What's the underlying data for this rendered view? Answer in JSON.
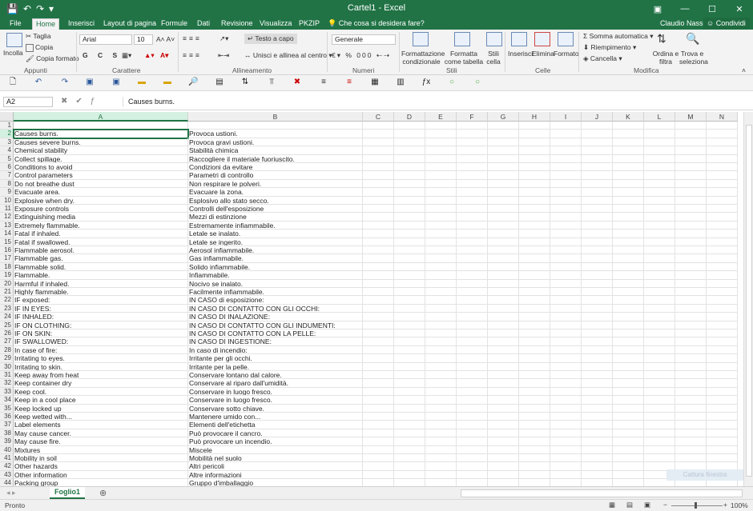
{
  "window": {
    "title": "Cartel1 - Excel",
    "user": "Claudio Nasso",
    "share": "Condividi"
  },
  "tabs": [
    "File",
    "Home",
    "Inserisci",
    "Layout di pagina",
    "Formule",
    "Dati",
    "Revisione",
    "Visualizza",
    "PKZIP"
  ],
  "tell_me": "Che cosa si desidera fare?",
  "ribbon": {
    "clipboard": {
      "paste": "Incolla",
      "cut": "Taglia",
      "copy": "Copia",
      "format_painter": "Copia formato",
      "group": "Appunti"
    },
    "font": {
      "name": "Arial",
      "size": "10",
      "group": "Carattere"
    },
    "alignment": {
      "wrap": "Testo a capo",
      "merge": "Unisci e allinea al centro",
      "group": "Allineamento"
    },
    "number": {
      "format": "Generale",
      "group": "Numeri"
    },
    "styles": {
      "cond": "Formattazione condizionale",
      "table": "Formatta come tabella",
      "cell": "Stili cella",
      "group": "Stili"
    },
    "cells": {
      "insert": "Inserisci",
      "delete": "Elimina",
      "format": "Formato",
      "group": "Celle"
    },
    "editing": {
      "autosum": "Somma automatica",
      "fill": "Riempimento",
      "clear": "Cancella",
      "sort": "Ordina e filtra",
      "find": "Trova e seleziona",
      "group": "Modifica"
    }
  },
  "formula_bar": {
    "name_box": "A2",
    "content": "Causes burns."
  },
  "columns": [
    "A",
    "B",
    "C",
    "D",
    "E",
    "F",
    "G",
    "H",
    "I",
    "J",
    "K",
    "L",
    "M",
    "N"
  ],
  "rows": [
    [
      "1",
      "",
      ""
    ],
    [
      "2",
      "Causes burns.",
      "Provoca ustioni."
    ],
    [
      "3",
      "Causes severe burns.",
      "Provoca gravi ustioni."
    ],
    [
      "4",
      "Chemical stability",
      "Stabilità chimica"
    ],
    [
      "5",
      "Collect spillage.",
      "Raccogliere il materiale fuoriuscito."
    ],
    [
      "6",
      "Conditions to avoid",
      "Condizioni da evitare"
    ],
    [
      "7",
      "Control parameters",
      "Parametri di controllo"
    ],
    [
      "8",
      "Do not breathe dust",
      "Non respirare le polveri."
    ],
    [
      "9",
      "Evacuate area.",
      "Evacuare la zona."
    ],
    [
      "10",
      "Explosive when dry.",
      "Esplosivo allo stato secco."
    ],
    [
      "11",
      "Exposure controls",
      "Controlli dell'esposizione"
    ],
    [
      "12",
      "Extinguishing media",
      "Mezzi di estinzione"
    ],
    [
      "13",
      "Extremely flammable.",
      "Estremamente infiammabile."
    ],
    [
      "14",
      "Fatal if inhaled.",
      "Letale se inalato."
    ],
    [
      "15",
      "Fatal if swallowed.",
      "Letale se ingerito."
    ],
    [
      "16",
      "Flammable aerosol.",
      "Aerosol infiammabile."
    ],
    [
      "17",
      "Flammable gas.",
      "Gas infiammabile."
    ],
    [
      "18",
      "Flammable solid.",
      "Solido infiammabile."
    ],
    [
      "19",
      "Flammable.",
      "Infiammabile."
    ],
    [
      "20",
      "Harmful if inhaled.",
      "Nocivo se inalato."
    ],
    [
      "21",
      "Highly flammable.",
      "Facilmente infiammabile."
    ],
    [
      "22",
      "IF exposed:",
      "IN CASO di esposizione:"
    ],
    [
      "23",
      "IF IN EYES:",
      "IN CASO DI CONTATTO CON GLI OCCHI:"
    ],
    [
      "24",
      "IF INHALED:",
      "IN CASO DI INALAZIONE:"
    ],
    [
      "25",
      "IF ON CLOTHING:",
      "IN CASO DI CONTATTO CON GLI INDUMENTI:"
    ],
    [
      "26",
      "IF ON SKIN:",
      "IN CASO DI CONTATTO CON LA PELLE:"
    ],
    [
      "27",
      "IF SWALLOWED:",
      "IN CASO DI INGESTIONE:"
    ],
    [
      "28",
      "In case of fire:",
      "In caso di incendio:"
    ],
    [
      "29",
      "Irritating to eyes.",
      "Irritante per gli occhi."
    ],
    [
      "30",
      "Irritating to skin.",
      "Irritante per la pelle."
    ],
    [
      "31",
      "Keep away from heat",
      "Conservare lontano dal calore."
    ],
    [
      "32",
      "Keep container dry",
      "Conservare al riparo dall'umidità."
    ],
    [
      "33",
      "Keep cool.",
      "Conservare in luogo fresco."
    ],
    [
      "34",
      "Keep in a cool place",
      "Conservare in luogo fresco."
    ],
    [
      "35",
      "Keep locked up",
      "Conservare sotto chiave."
    ],
    [
      "36",
      "Keep wetted with...",
      "Mantenere umido con..."
    ],
    [
      "37",
      "Label elements",
      "Elementi dell'etichetta"
    ],
    [
      "38",
      "May cause cancer.",
      "Può provocare il cancro."
    ],
    [
      "39",
      "May cause fire.",
      "Può provocare un incendio."
    ],
    [
      "40",
      "Mixtures",
      "Miscele"
    ],
    [
      "41",
      "Mobility in soil",
      "Mobilità nel suolo"
    ],
    [
      "42",
      "Other hazards",
      "Altri pericoli"
    ],
    [
      "43",
      "Other information",
      "Altre informazioni"
    ],
    [
      "44",
      "Packing group",
      "Gruppo d'imballaggio"
    ]
  ],
  "sheet_tab": "Foglio1",
  "status": {
    "ready": "Pronto",
    "zoom": "100%"
  },
  "ghost_text": "Cattura finestra"
}
